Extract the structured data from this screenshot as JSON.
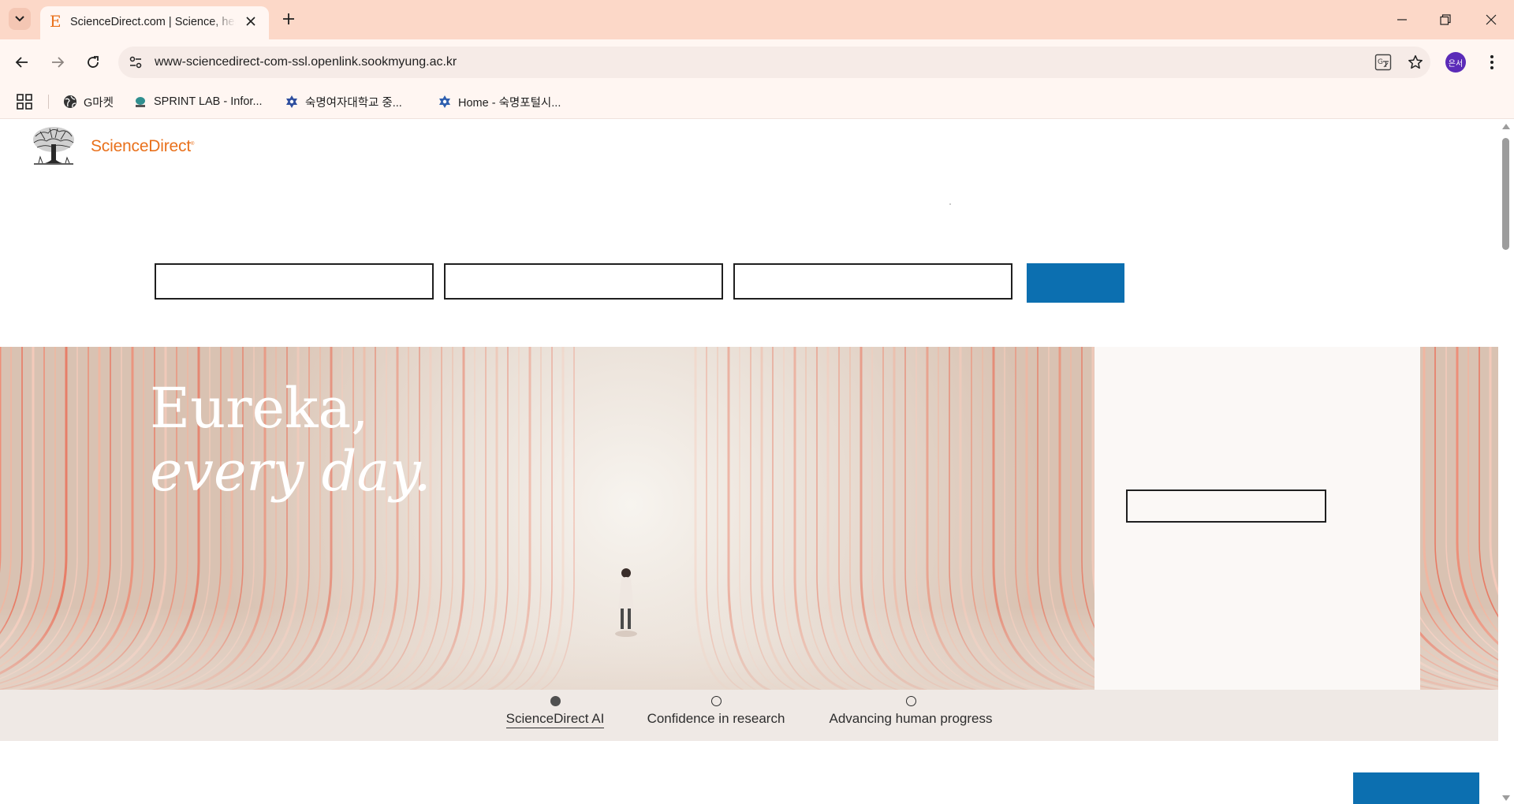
{
  "browser": {
    "tab": {
      "favicon": "E",
      "title": "ScienceDirect.com | Science, health and medical journals"
    },
    "url": "www-sciencedirect-com-ssl.openlink.sookmyung.ac.kr",
    "profile_initials": "은서",
    "bookmarks": [
      {
        "label": "G마켓",
        "icon": "globe-icon"
      },
      {
        "label": "SPRINT LAB - Infor...",
        "icon": "lab-icon"
      },
      {
        "label": "숙명여자대학교 중...",
        "icon": "star-of-david-icon"
      },
      {
        "label": "Home - 숙명포털시...",
        "icon": "star-of-david-icon"
      }
    ]
  },
  "page": {
    "logo_text": "ScienceDirect",
    "hero": {
      "line1": "Eureka,",
      "line2": "every day."
    },
    "carousel": {
      "tabs": [
        {
          "label": "ScienceDirect AI",
          "active": true
        },
        {
          "label": "Confidence in research",
          "active": false
        },
        {
          "label": "Advancing human progress",
          "active": false
        }
      ]
    },
    "colors": {
      "brand_orange": "#e9711c",
      "brand_blue": "#0c6fb0",
      "tabbar": "#fcd8c8"
    }
  }
}
